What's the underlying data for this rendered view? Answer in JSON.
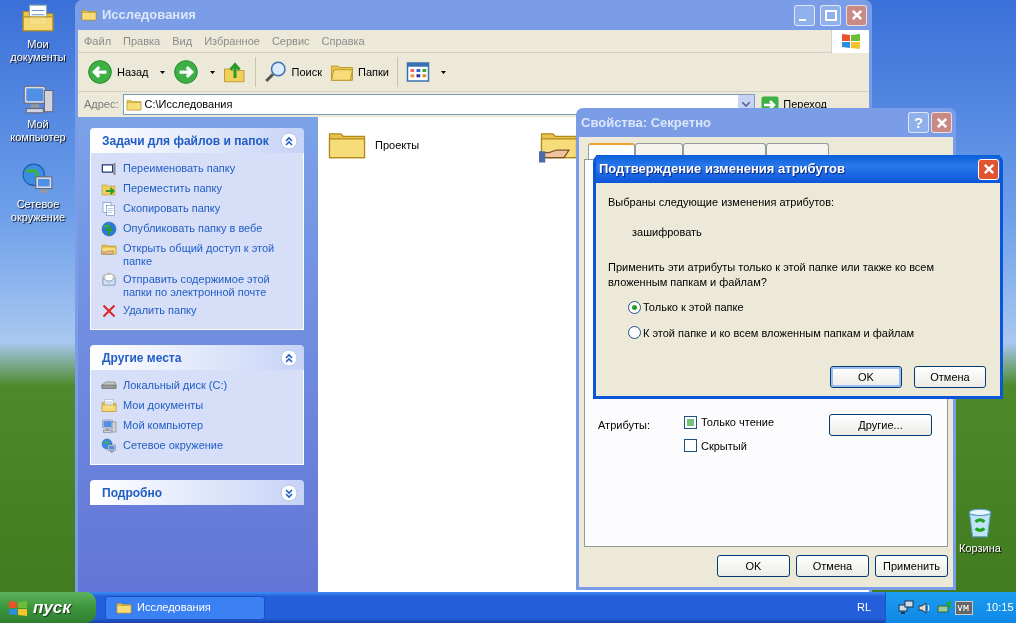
{
  "desktop_icons": [
    {
      "kind": "documents",
      "label": "Мои документы"
    },
    {
      "kind": "computer",
      "label": "Мой компьютер"
    },
    {
      "kind": "network",
      "label": "Сетевое окружение"
    },
    {
      "kind": "recycle",
      "label": "Корзина"
    }
  ],
  "explorer": {
    "title": "Исследования",
    "menu": [
      "Файл",
      "Правка",
      "Вид",
      "Избранное",
      "Сервис",
      "Справка"
    ],
    "toolbar": [
      {
        "kind": "back",
        "label": "Назад",
        "dropdown": true
      },
      {
        "kind": "forward",
        "dropdown": true
      },
      {
        "kind": "up"
      },
      {
        "kind": "search",
        "label": "Поиск"
      },
      {
        "kind": "folders",
        "label": "Папки"
      },
      {
        "kind": "views",
        "dropdown": true
      }
    ],
    "address": {
      "label": "Адрес:",
      "value": "C:\\Исследования",
      "go": "Переход"
    },
    "panels": [
      {
        "title": "Задачи для файлов и папок",
        "expanded": true,
        "items": [
          {
            "kind": "rename",
            "label": "Переименовать папку"
          },
          {
            "kind": "move",
            "label": "Переместить папку"
          },
          {
            "kind": "copy",
            "label": "Скопировать папку"
          },
          {
            "kind": "publish",
            "label": "Опубликовать папку в вебе"
          },
          {
            "kind": "share",
            "label": "Открыть общий доступ к этой папке"
          },
          {
            "kind": "email",
            "label": "Отправить содержимое этой папки по электронной почте"
          },
          {
            "kind": "delete",
            "label": "Удалить папку"
          }
        ]
      },
      {
        "title": "Другие места",
        "expanded": true,
        "items": [
          {
            "kind": "disk",
            "label": "Локальный диск (C:)"
          },
          {
            "kind": "documents",
            "label": "Мои документы"
          },
          {
            "kind": "computer",
            "label": "Мой компьютер"
          },
          {
            "kind": "network",
            "label": "Сетевое окружение"
          }
        ]
      },
      {
        "title": "Подробно",
        "expanded": false
      }
    ],
    "files": [
      {
        "kind": "folder",
        "name": "Проекты"
      },
      {
        "kind": "shared"
      }
    ]
  },
  "properties": {
    "title": "Свойства: Секретно",
    "help": "?",
    "tabs": [
      {
        "selected": true
      },
      {
        "selected": false
      },
      {
        "selected": false
      },
      {
        "selected": false
      }
    ],
    "attributes_label": "Атрибуты:",
    "attributes": [
      {
        "label": "Только чтение",
        "checked": false,
        "indeterminate": true
      },
      {
        "label": "Скрытый",
        "checked": false,
        "indeterminate": false
      }
    ],
    "other_button": "Другие...",
    "buttons": [
      "OK",
      "Отмена",
      "Применить"
    ]
  },
  "confirm": {
    "title": "Подтверждение изменения атрибутов",
    "intro": "Выбраны следующие изменения атрибутов:",
    "change": "зашифровать",
    "question": "Применить эти атрибуты только к этой папке или также ко всем вложенным папкам и файлам?",
    "options": [
      {
        "label": "Только к этой папке",
        "selected": true
      },
      {
        "label": "К этой папке и ко всем вложенным папкам и файлам",
        "selected": false
      }
    ],
    "buttons": [
      "OK",
      "Отмена"
    ]
  },
  "taskbar": {
    "start": "пуск",
    "tasks": [
      {
        "label": "Исследования",
        "selected": false
      }
    ],
    "language": "RL",
    "clock": "10:15"
  }
}
